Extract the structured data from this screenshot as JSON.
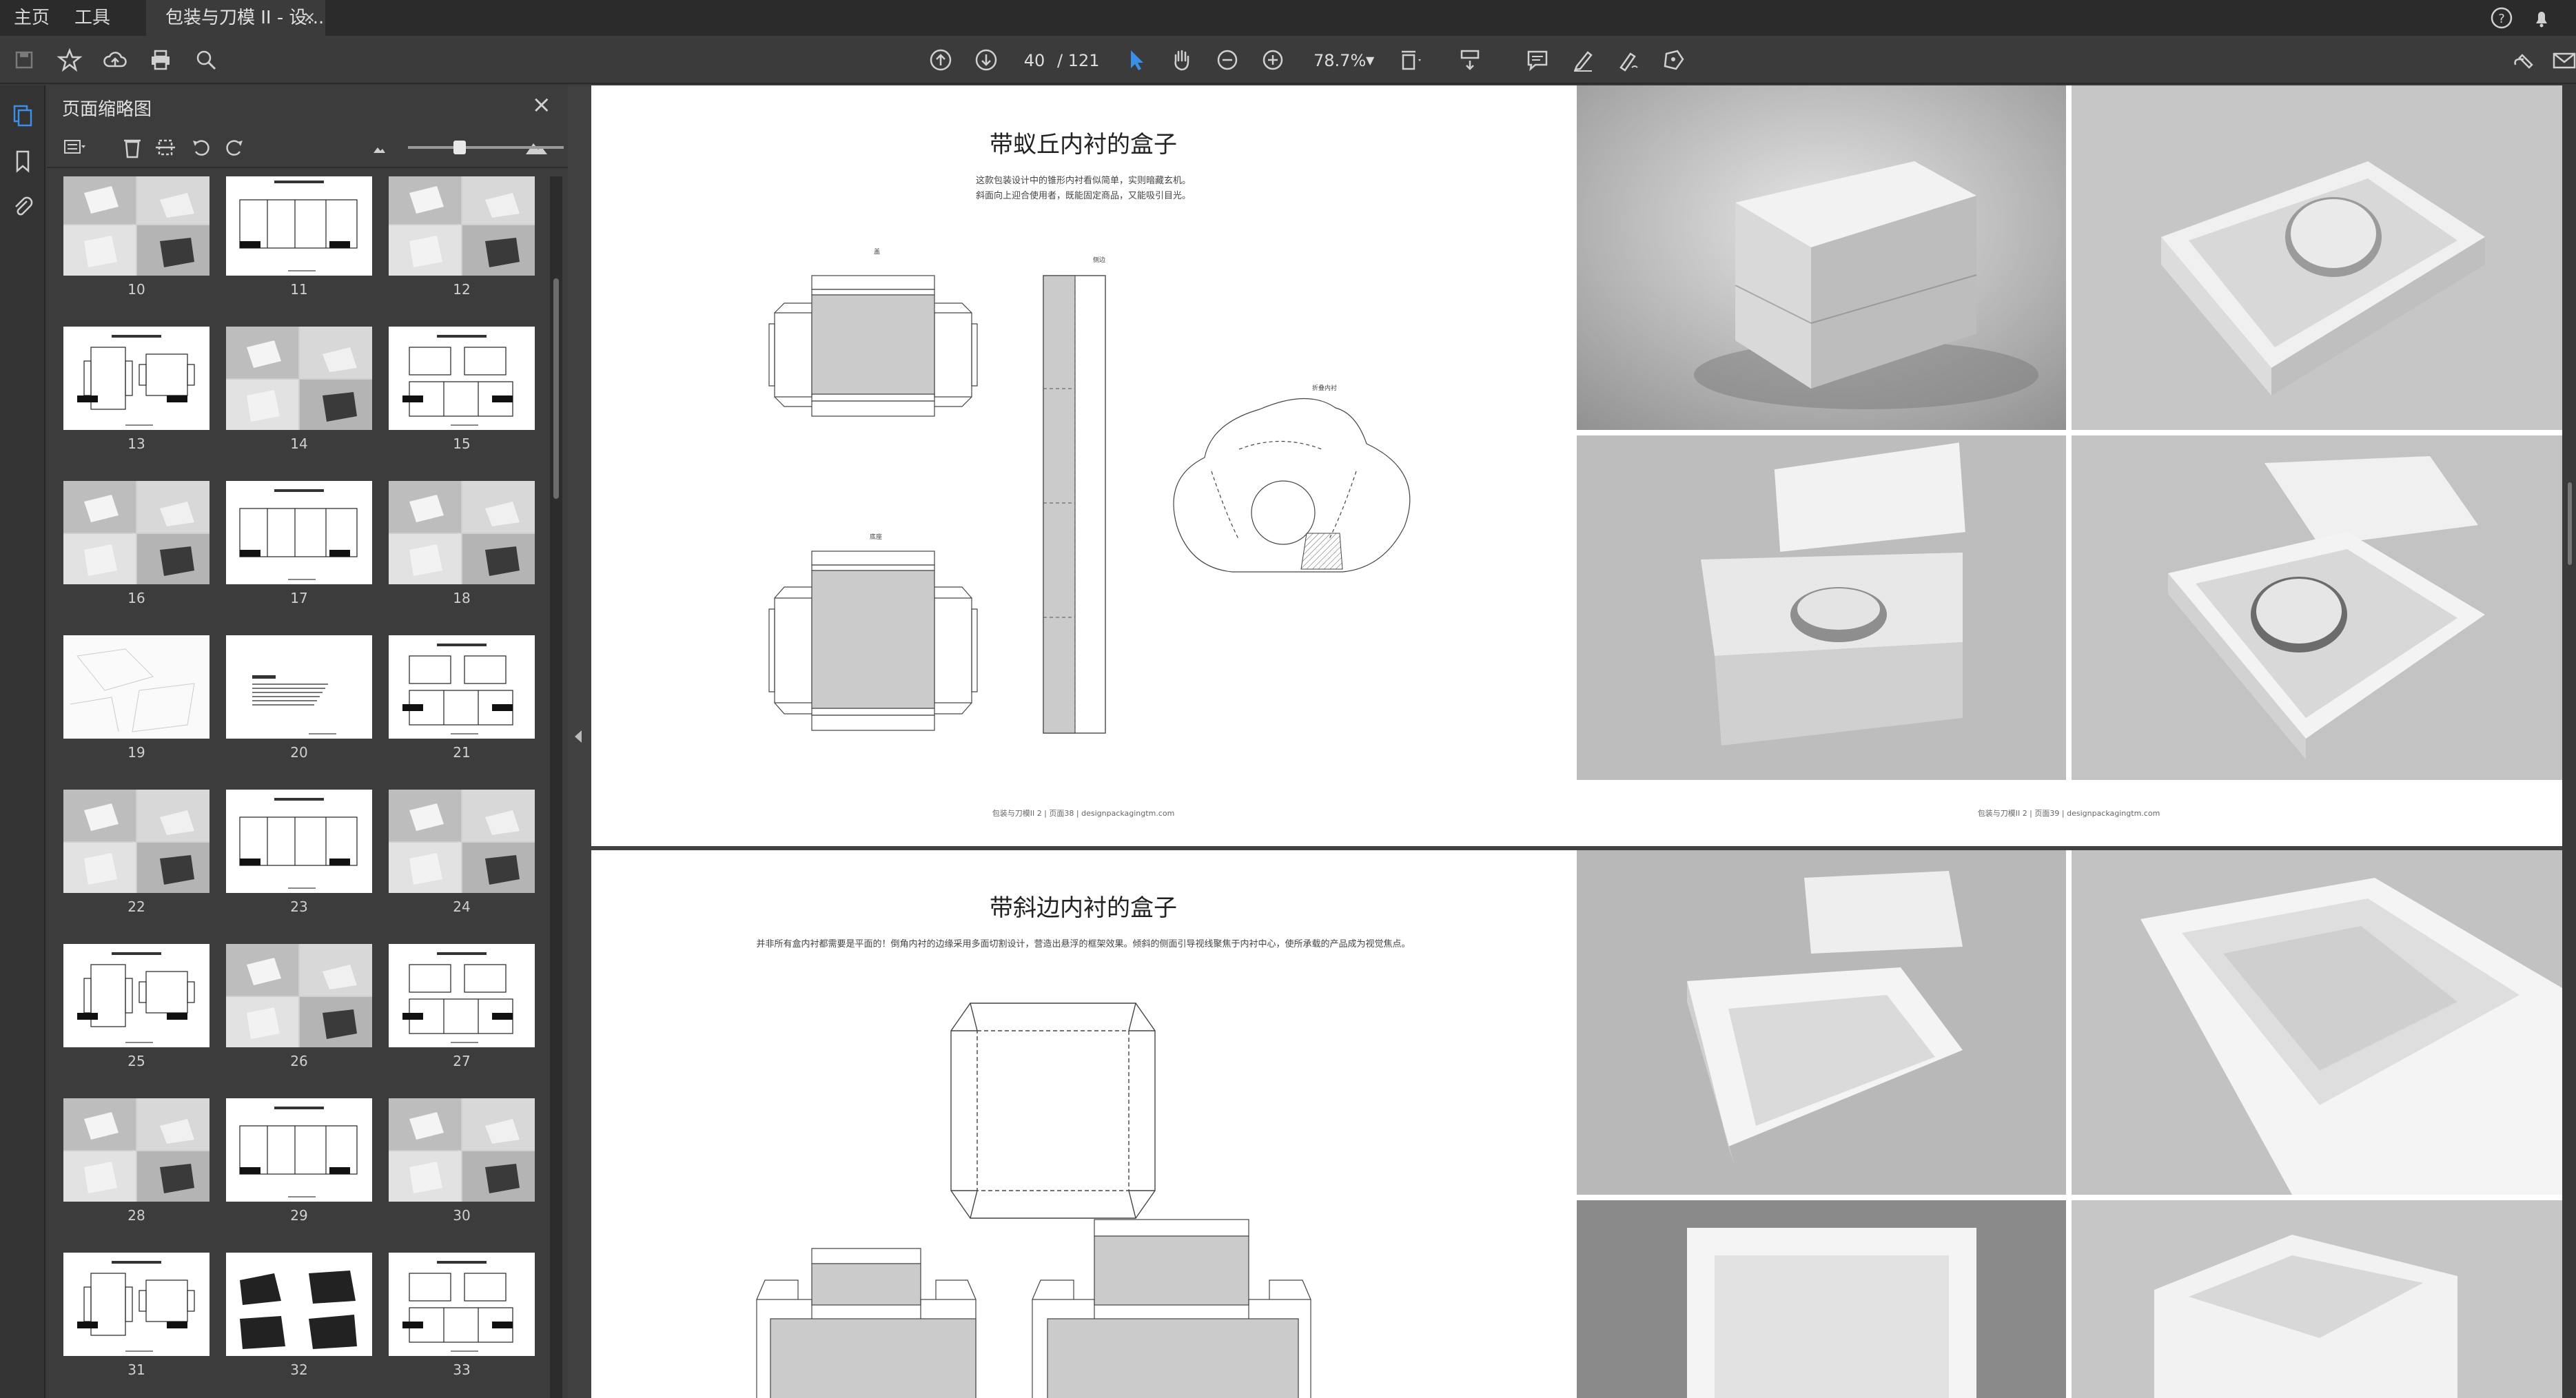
{
  "menubar": {
    "home": "主页",
    "tools": "工具",
    "doc_tab": "包装与刀模 II - 设...",
    "close": "×"
  },
  "toolbar": {
    "page_current": "40",
    "page_total": "/ 121",
    "zoom": "78.7%"
  },
  "thumbnails": {
    "title": "页面缩略图",
    "close": "×",
    "pages": [
      {
        "num": "10",
        "kind": "photo"
      },
      {
        "num": "11",
        "kind": "dieline"
      },
      {
        "num": "12",
        "kind": "photo"
      },
      {
        "num": "13",
        "kind": "dieline"
      },
      {
        "num": "14",
        "kind": "photo"
      },
      {
        "num": "15",
        "kind": "dieline"
      },
      {
        "num": "16",
        "kind": "photo"
      },
      {
        "num": "17",
        "kind": "dieline"
      },
      {
        "num": "18",
        "kind": "photo"
      },
      {
        "num": "19",
        "kind": "sketch"
      },
      {
        "num": "20",
        "kind": "text"
      },
      {
        "num": "21",
        "kind": "dieline"
      },
      {
        "num": "22",
        "kind": "photo"
      },
      {
        "num": "23",
        "kind": "dieline"
      },
      {
        "num": "24",
        "kind": "photo"
      },
      {
        "num": "25",
        "kind": "dieline"
      },
      {
        "num": "26",
        "kind": "photo"
      },
      {
        "num": "27",
        "kind": "dieline"
      },
      {
        "num": "28",
        "kind": "photo"
      },
      {
        "num": "29",
        "kind": "dieline"
      },
      {
        "num": "30",
        "kind": "photo"
      },
      {
        "num": "31",
        "kind": "dieline"
      },
      {
        "num": "32",
        "kind": "dark"
      },
      {
        "num": "33",
        "kind": "dieline"
      }
    ]
  },
  "spread1": {
    "title": "带蚁丘内衬的盒子",
    "desc_line1": "这款包装设计中的锥形内衬看似简单，实则暗藏玄机。",
    "desc_line2": "斜面向上迎合使用者，既能固定商品，又能吸引目光。",
    "label_lid": "盖",
    "label_insert_wall": "侧边",
    "label_base": "底座",
    "label_insert": "折叠内衬",
    "footer_left": "包装与刀模II 2 |",
    "footer_mid": "页面38",
    "footer_right": "| designpackagingtm.com",
    "footer2_left": "包装与刀模II 2 |",
    "footer2_mid": "页面39",
    "footer2_right": "| designpackagingtm.com"
  },
  "spread2": {
    "title": "带斜边内衬的盒子",
    "desc": "并非所有盒内衬都需要是平面的！倒角内衬的边缘采用多面切割设计，营造出悬浮的框架效果。倾斜的侧面引导视线聚焦于内衬中心，使所承载的产品成为视觉焦点。"
  }
}
